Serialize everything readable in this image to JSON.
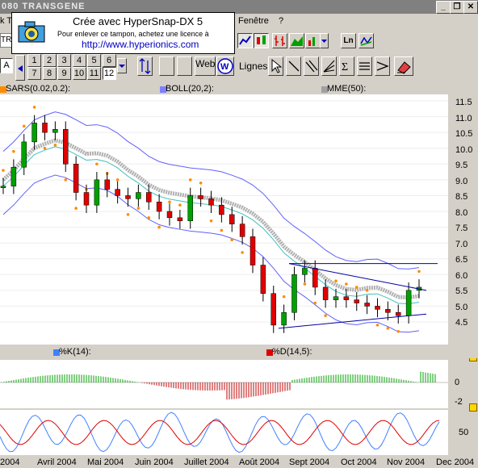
{
  "window": {
    "title": "080  TRANSGENE",
    "minimize": "_",
    "restore": "❐",
    "close": "✕"
  },
  "menu": {
    "left": "k Te",
    "fenetre": "Fenêtre",
    "help": "?"
  },
  "stamp": {
    "line1": "Crée avec HyperSnap-DX 5",
    "line2": "Pour enlever ce tampon, achetez une licence à",
    "line3": "http://www.hyperionics.com"
  },
  "toolbar": {
    "ticker_field": "TRA",
    "a_button": "A",
    "numbers_row1": [
      "1",
      "2",
      "3",
      "4",
      "5",
      "6"
    ],
    "numbers_row2": [
      "7",
      "8",
      "9",
      "10",
      "11",
      "12"
    ],
    "web_label": "Web",
    "w_button": "W",
    "lignes_label": "Lignes",
    "ln_button": "Ln",
    "colors": {
      "chart_up": "#00a000",
      "chart_down": "#e00000"
    }
  },
  "indicators_top": [
    {
      "label": "SARS(0.02,0.2):",
      "color": "#ff8c00"
    },
    {
      "label": "BOLL(20,2):",
      "color": "#8080ff"
    },
    {
      "label": "MME(50):",
      "color": "#a0a0a0"
    }
  ],
  "indicators_bottom": [
    {
      "label": "%K(14):",
      "color": "#4080ff"
    },
    {
      "label": "%D(14,5):",
      "color": "#e00000"
    }
  ],
  "price_axis": [
    "11.5",
    "11.0",
    "10.5",
    "10.0",
    "9.5",
    "9.0",
    "8.5",
    "8.0",
    "7.5",
    "7.0",
    "6.5",
    "6.0",
    "5.5",
    "5.0",
    "4.5"
  ],
  "macd_axis": [
    "0",
    "-2"
  ],
  "stoch_axis": [
    "50"
  ],
  "dates": [
    "2004",
    "Avril 2004",
    "Mai 2004",
    "Juin 2004",
    "Juillet 2004",
    "Août 2004",
    "Sept 2004",
    "Oct 2004",
    "Nov 2004",
    "Dec 2004"
  ],
  "chart_data": {
    "type": "candlestick",
    "title": "080  TRANSGENE",
    "xlabel": "",
    "ylabel": "",
    "ylim": [
      4.2,
      11.6
    ],
    "x_categories": [
      "2004",
      "Avril 2004",
      "Mai 2004",
      "Juin 2004",
      "Juillet 2004",
      "Août 2004",
      "Sept 2004",
      "Oct 2004",
      "Nov 2004",
      "Dec 2004"
    ],
    "close_approx": [
      8.8,
      9.4,
      10.2,
      10.8,
      10.5,
      10.6,
      9.5,
      8.6,
      8.2,
      9.0,
      8.7,
      8.5,
      8.4,
      8.6,
      8.3,
      8.0,
      7.8,
      7.7,
      8.5,
      8.4,
      8.2,
      7.9,
      7.6,
      7.2,
      6.3,
      5.4,
      4.4,
      4.8,
      6.0,
      6.2,
      5.6,
      5.2,
      5.3,
      5.2,
      5.1,
      5.0,
      4.9,
      4.8,
      4.7,
      5.5,
      5.6
    ],
    "series": [
      {
        "name": "SARS(0.02,0.2)"
      },
      {
        "name": "BOLL(20,2)"
      },
      {
        "name": "MME(50)"
      },
      {
        "name": "%K(14)"
      },
      {
        "name": "%D(14,5)"
      }
    ]
  }
}
